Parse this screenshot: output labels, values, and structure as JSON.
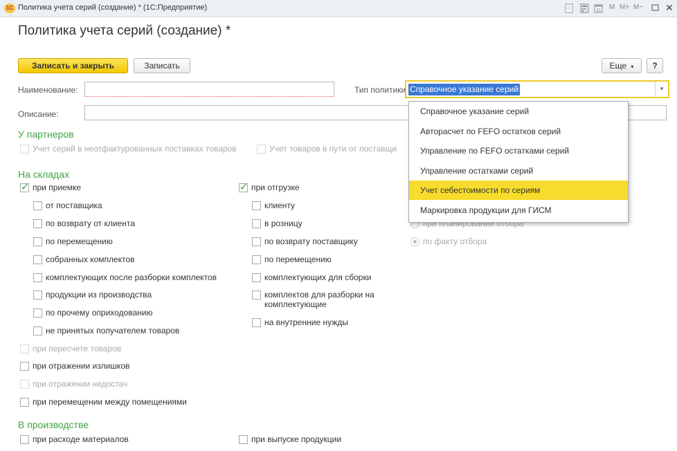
{
  "window": {
    "app_logo": "1С",
    "title": "Политика учета серий (создание) * (1С:Предприятие)",
    "toolbar": [
      "M",
      "M+",
      "M−"
    ],
    "toolbar_icons": [
      "doc-icon",
      "calculator-icon",
      "calendar-icon",
      "restore-icon",
      "close-icon"
    ]
  },
  "form": {
    "title": "Политика учета серий (создание) *",
    "buttons": {
      "save_close": "Записать и закрыть",
      "save": "Записать",
      "more": "Еще",
      "help": "?"
    },
    "name_label": "Наименование:",
    "name_value": "",
    "type_label": "Тип политики:",
    "type_value": "Справочное указание серий",
    "desc_label": "Описание:",
    "desc_value": ""
  },
  "dropdown": {
    "options": [
      "Справочное указание серий",
      "Авторасчет по FEFO остатков серий",
      "Управление по FEFO остатками серий",
      "Управление остатками серий",
      "Учет себестоимости по сериям",
      "Маркировка продукции для ГИСМ"
    ],
    "highlighted": 4
  },
  "partners": {
    "title": "У партнеров",
    "cb1": "Учет серий в неотфактурованных поставках товаров",
    "cb2": "Учет товаров в пути от поставщи"
  },
  "warehouses": {
    "title": "На складах",
    "receipt": {
      "label": "при приемке",
      "checked": true,
      "items": [
        "от поставщика",
        "по возврату от клиента",
        "по перемещению",
        "собранных комплектов",
        "комплектующих после разборки комплектов",
        "продукции из производства",
        "по прочему оприходованию",
        "не принятых получателем товаров"
      ]
    },
    "shipment": {
      "label": "при отгрузке",
      "checked": true,
      "items": [
        "клиенту",
        "в розницу",
        "по возврату поставщику",
        "по перемещению",
        "комплектующих для сборки",
        "комплектов для разборки на",
        "комплектующие",
        "на внутренние нужды"
      ]
    },
    "radios": {
      "r1": "при планировании отбора",
      "r2": "по факту отбора"
    },
    "recount": "при пересчете товаров",
    "surplus": "при отражении излишков",
    "shortage": "при отражении недостач",
    "movement": "при перемещении между помещениями"
  },
  "production": {
    "title": "В производстве",
    "materials": "при расходе материалов",
    "output": "при выпуске продукции"
  }
}
